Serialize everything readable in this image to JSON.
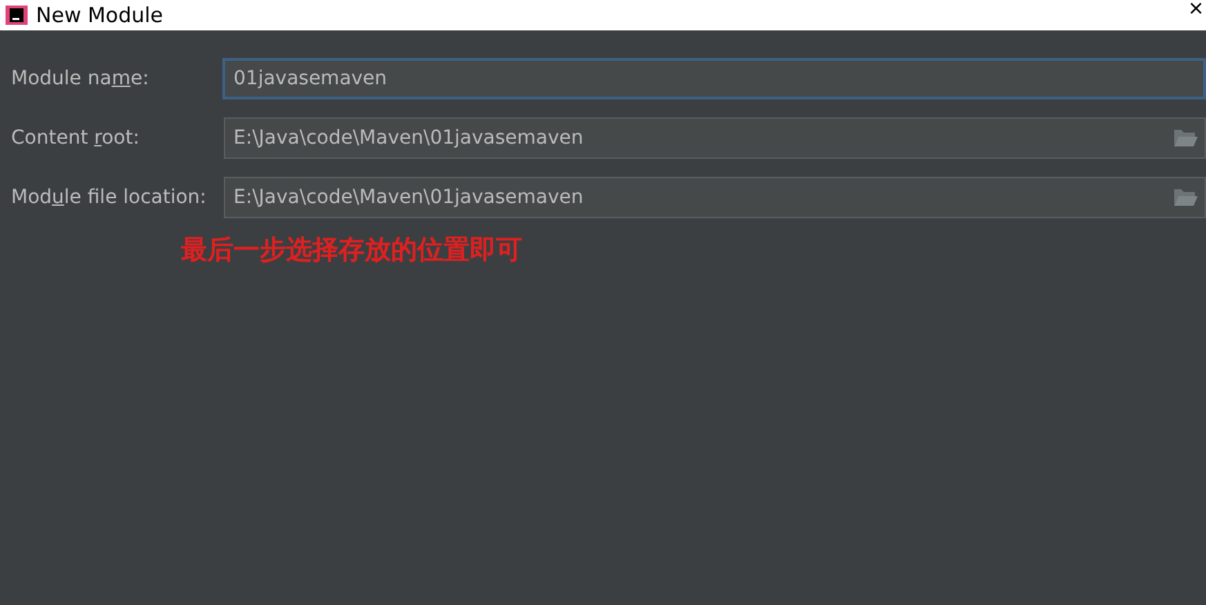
{
  "window": {
    "title": "New Module",
    "close": "×"
  },
  "fields": [
    {
      "label_before": "Module na",
      "label_key": "m",
      "label_after": "e:",
      "value": "01javasemaven",
      "focused": true,
      "browse": false
    },
    {
      "label_before": "Content ",
      "label_key": "r",
      "label_after": "oot:",
      "value": "E:\\Java\\code\\Maven\\01javasemaven",
      "focused": false,
      "browse": true
    },
    {
      "label_before": "Mod",
      "label_key": "u",
      "label_after": "le file location:",
      "value": "E:\\Java\\code\\Maven\\01javasemaven",
      "focused": false,
      "browse": true
    }
  ],
  "annotation": "最后一步选择存放的位置即可"
}
